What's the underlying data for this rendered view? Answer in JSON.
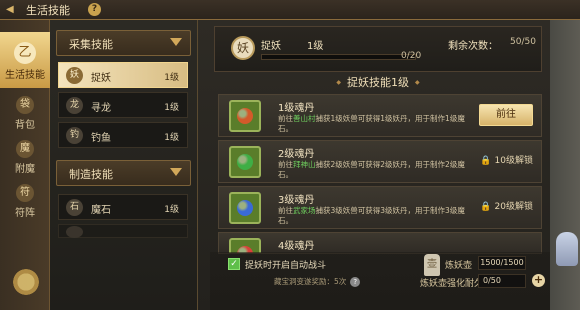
{
  "header": {
    "title": "生活技能",
    "back_glyph": "◀",
    "help_glyph": "?"
  },
  "left_tabs": [
    {
      "label": "生活技能",
      "icon": "life-skill-icon",
      "glyph": "乙"
    },
    {
      "label": "背包",
      "icon": "bag-icon",
      "glyph": "袋"
    },
    {
      "label": "附魔",
      "icon": "enchant-icon",
      "glyph": "魔"
    },
    {
      "label": "符阵",
      "icon": "rune-array-icon",
      "glyph": "符"
    }
  ],
  "categories": [
    {
      "label": "采集技能",
      "skills": [
        {
          "name": "捉妖",
          "level": "1级",
          "glyph": "妖",
          "selected": true
        },
        {
          "name": "寻龙",
          "level": "1级",
          "glyph": "龙",
          "selected": false
        },
        {
          "name": "钓鱼",
          "level": "1级",
          "glyph": "钓",
          "selected": false
        }
      ]
    },
    {
      "label": "制造技能",
      "skills": [
        {
          "name": "魔石",
          "level": "1级",
          "glyph": "石",
          "selected": false
        },
        {
          "name": "",
          "level": "",
          "glyph": "",
          "selected": false
        }
      ]
    }
  ],
  "current_skill": {
    "name": "捉妖",
    "level": "1级",
    "glyph": "妖",
    "progress_text": "0/20",
    "progress_value": 0,
    "remaining_label": "剩余次数：",
    "remaining_value": "50/50"
  },
  "section_title": "捉妖技能1级",
  "recipes": [
    {
      "title": "1级魂丹",
      "desc_prefix": "前往",
      "location": "善山村",
      "desc_suffix": "捕获1级妖兽可获得1级妖丹，用于制作1级魔石。",
      "action": "前往",
      "lock_text": "",
      "gem_color": "#d35a2a"
    },
    {
      "title": "2级魂丹",
      "desc_prefix": "前往",
      "location": "拜神山",
      "desc_suffix": "捕获2级妖兽可获得2级妖丹，用于制作2级魔石。",
      "action": "",
      "lock_text": "10级解锁",
      "gem_color": "#3fae45"
    },
    {
      "title": "3级魂丹",
      "desc_prefix": "前往",
      "location": "武家场",
      "desc_suffix": "捕获3级妖兽可获得3级妖丹，用于制作3级魔石。",
      "action": "",
      "lock_text": "20级解锁",
      "gem_color": "#3a6ad6"
    },
    {
      "title": "4级魂丹",
      "desc_prefix": "",
      "location": "",
      "desc_suffix": "",
      "action": "",
      "lock_text": "",
      "gem_color": "#d9413a"
    }
  ],
  "bottom": {
    "auto_battle_label": "捉妖时开启自动战斗",
    "auto_battle_checked": true,
    "reward_text": "藏宝洞变遂奖励：5次",
    "reward_bubble": "?",
    "pot_label": "炼妖壶",
    "pot_value": "1500/1500",
    "durability_label": "炼妖壶强化耐久",
    "durability_value": "0/50",
    "plus_glyph": "+"
  },
  "accent_colors": {
    "gold": "#d6a84a",
    "green": "#6fcf5e",
    "panel": "#2e2b25"
  }
}
